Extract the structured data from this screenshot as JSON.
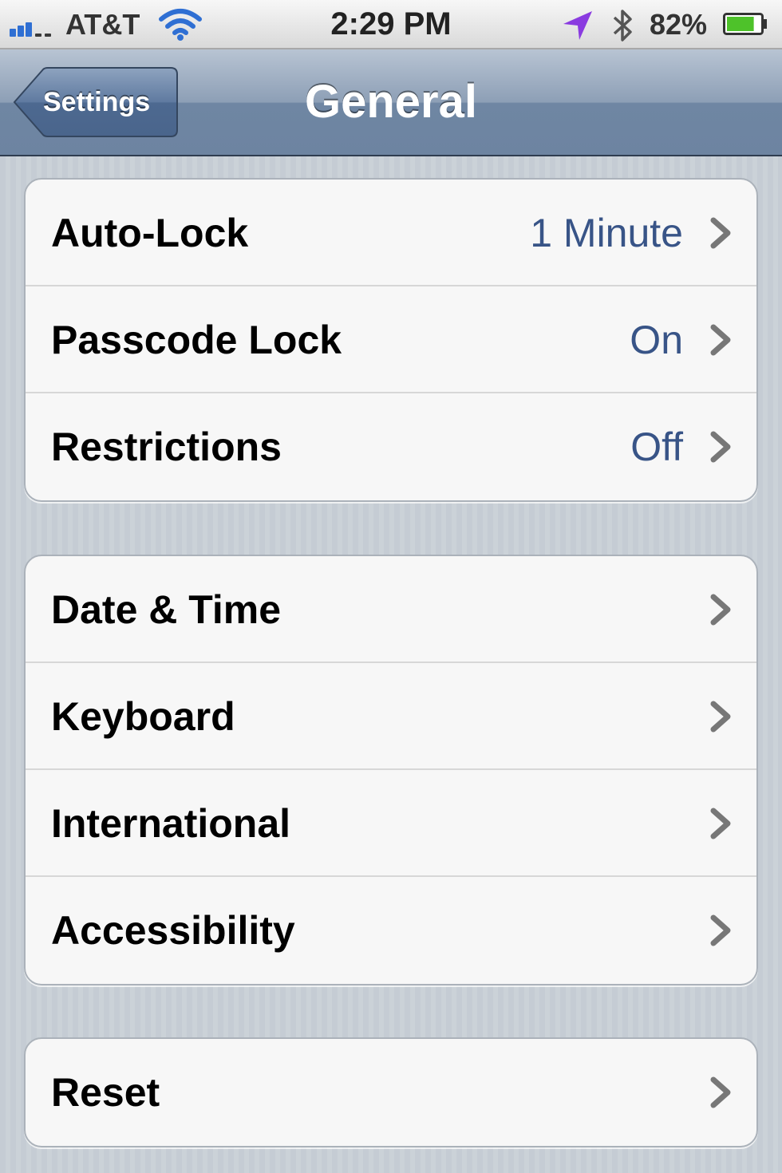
{
  "status_bar": {
    "carrier": "AT&T",
    "time": "2:29 PM",
    "battery_percent": "82%",
    "battery_level": 0.82,
    "icons": [
      "signal-bars-icon",
      "wifi-icon",
      "location-arrow-icon",
      "bluetooth-icon",
      "battery-icon"
    ]
  },
  "nav_bar": {
    "back_label": "Settings",
    "title": "General"
  },
  "groups": [
    {
      "rows": [
        {
          "label": "Auto-Lock",
          "value": "1 Minute"
        },
        {
          "label": "Passcode Lock",
          "value": "On"
        },
        {
          "label": "Restrictions",
          "value": "Off"
        }
      ]
    },
    {
      "rows": [
        {
          "label": "Date & Time",
          "value": ""
        },
        {
          "label": "Keyboard",
          "value": ""
        },
        {
          "label": "International",
          "value": ""
        },
        {
          "label": "Accessibility",
          "value": ""
        }
      ]
    },
    {
      "rows": [
        {
          "label": "Reset",
          "value": ""
        }
      ]
    }
  ],
  "colors": {
    "value_text": "#385487",
    "nav_bar": "#6f86a3",
    "signal_active": "#2f6fd3",
    "location_arrow": "#8a3be0",
    "battery_fill": "#4ec22a"
  }
}
